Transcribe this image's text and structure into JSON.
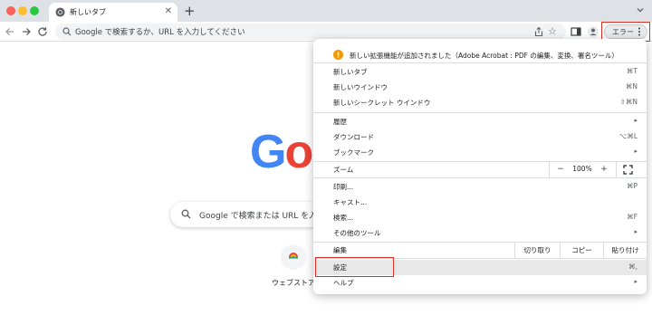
{
  "tab": {
    "title": "新しいタブ",
    "close": "✕",
    "new_tab": "+"
  },
  "omnibox": {
    "placeholder": "Google で検索するか、URL を入力してください"
  },
  "toolbar": {
    "error_label": "エラー"
  },
  "page": {
    "logo_visible": "Go",
    "search_placeholder": "Google で検索または URL を入",
    "shortcut_label": "ウェブストア"
  },
  "menu": {
    "notice": "新しい拡張機能が追加されました（Adobe Acrobat : PDF の編集、変換、署名ツール）",
    "items": {
      "new_tab": {
        "label": "新しいタブ",
        "shortcut": "⌘T"
      },
      "new_window": {
        "label": "新しいウインドウ",
        "shortcut": "⌘N"
      },
      "new_incognito": {
        "label": "新しいシークレット ウインドウ",
        "shortcut": "⇧⌘N"
      },
      "history": {
        "label": "履歴"
      },
      "downloads": {
        "label": "ダウンロード",
        "shortcut": "⌥⌘L"
      },
      "bookmarks": {
        "label": "ブックマーク"
      },
      "zoom": {
        "label": "ズーム",
        "minus": "−",
        "value": "100%",
        "plus": "+"
      },
      "print": {
        "label": "印刷...",
        "shortcut": "⌘P"
      },
      "cast": {
        "label": "キャスト..."
      },
      "find": {
        "label": "検索...",
        "shortcut": "⌘F"
      },
      "more_tools": {
        "label": "その他のツール"
      },
      "edit": {
        "label": "編集",
        "cut": "切り取り",
        "copy": "コピー",
        "paste": "貼り付け"
      },
      "settings": {
        "label": "設定",
        "shortcut": "⌘,"
      },
      "help": {
        "label": "ヘルプ"
      }
    },
    "submenu_arrow": "▸"
  },
  "colors": {
    "highlight_border": "#d93025",
    "google_blue": "#4285f4",
    "google_red": "#ea4335",
    "notice_orange": "#f29900"
  },
  "icons": [
    "chrome-favicon",
    "back-arrow-icon",
    "forward-arrow-icon",
    "reload-icon",
    "search-icon",
    "share-icon",
    "star-icon",
    "side-panel-icon",
    "profile-icon",
    "kebab-menu-icon",
    "warning-icon",
    "fullscreen-icon",
    "chevron-down-icon"
  ]
}
